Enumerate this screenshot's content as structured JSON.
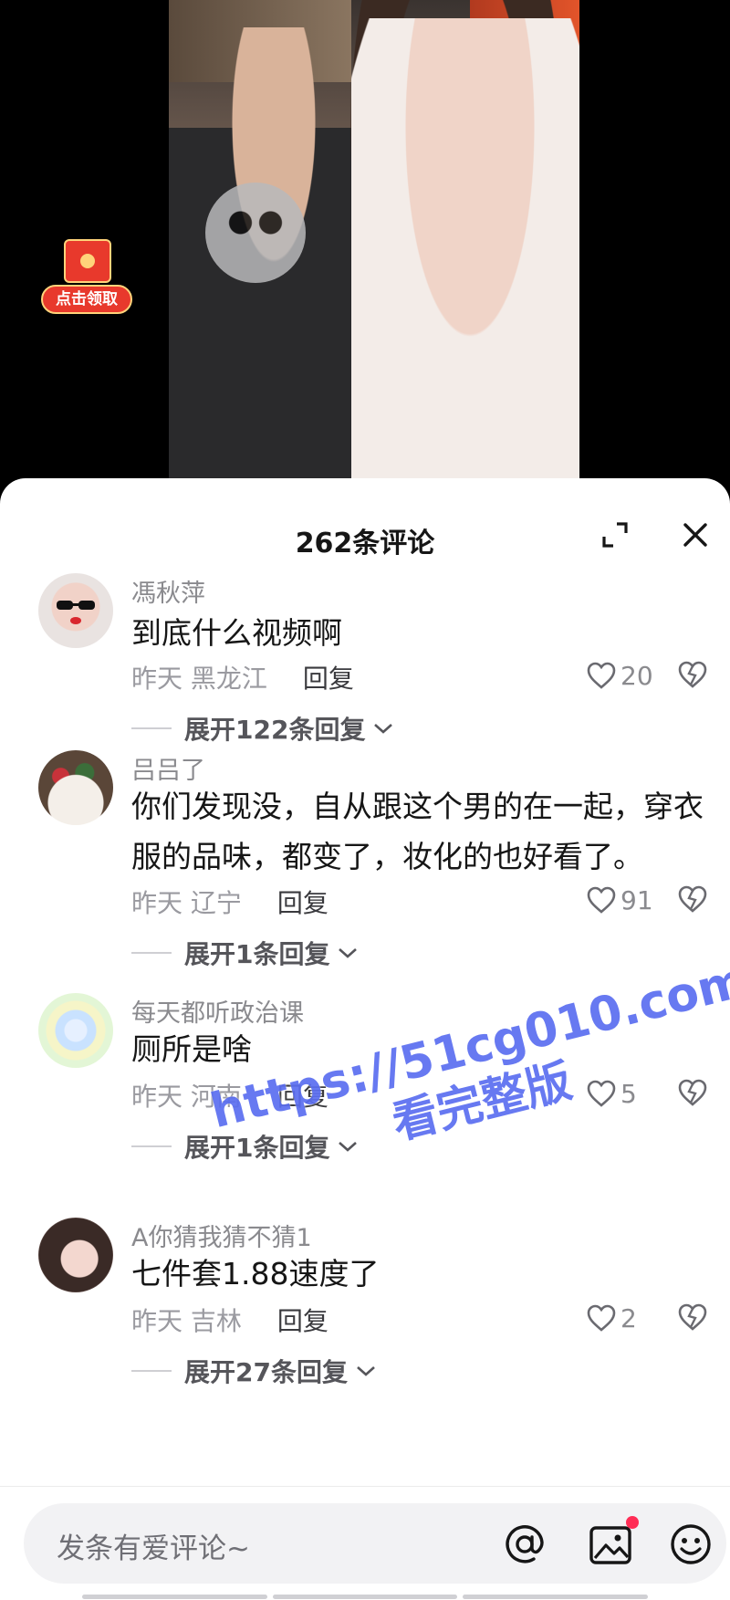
{
  "video": {
    "red_packet_label": "点击领取"
  },
  "sheet": {
    "title": "262条评论",
    "icons": {
      "expand": "expand-icon",
      "close": "close-icon"
    }
  },
  "comments": [
    {
      "user": "馮秋萍",
      "text": "到底什么视频啊",
      "time": "昨天",
      "location": "黑龙江",
      "reply_label": "回复",
      "likes": "20",
      "expand_label": "展开122条回复"
    },
    {
      "user": "吕吕了",
      "text": "你们发现没，自从跟这个男的在一起，穿衣服的品味，都变了，妆化的也好看了。",
      "time": "昨天",
      "location": "辽宁",
      "reply_label": "回复",
      "likes": "91",
      "expand_label": "展开1条回复"
    },
    {
      "user": "每天都听政治课",
      "text": "厕所是啥",
      "time": "昨天",
      "location": "河南",
      "reply_label": "回复",
      "likes": "5",
      "expand_label": "展开1条回复"
    },
    {
      "user": "A你猜我猜不猜1",
      "text": "七件套1.88速度了",
      "time": "昨天",
      "location": "吉林",
      "reply_label": "回复",
      "likes": "2",
      "expand_label": "展开27条回复"
    }
  ],
  "watermark": {
    "line1": "https://51cg010.com",
    "line2": "看完整版"
  },
  "bottom_bar": {
    "placeholder": "发条有爱评论~",
    "icons": [
      "at-icon",
      "image-icon",
      "emoji-icon"
    ],
    "image_badge_color": "#ff2d55"
  },
  "colors": {
    "red_packet": "#e8392c",
    "watermark": "#5b6ef0"
  }
}
